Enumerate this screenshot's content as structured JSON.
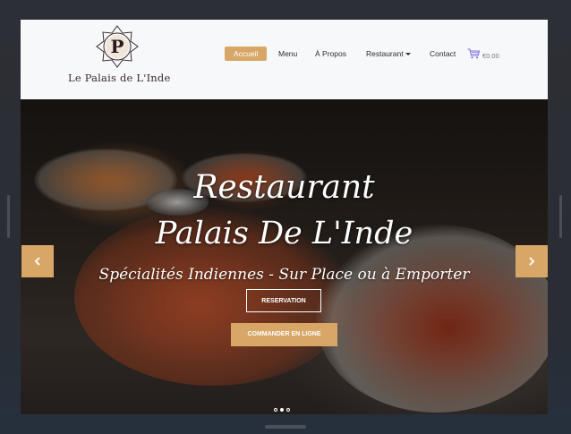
{
  "header": {
    "logo_text": "Le Palais de L'Inde",
    "logo_letter": "P",
    "nav": [
      "Accueil",
      "Menu",
      "À Propos",
      "Restaurant",
      "Contact"
    ],
    "active_nav": "Accueil",
    "cart_amount": "€0.00"
  },
  "hero": {
    "title_line1": "Restaurant",
    "title_line2": "Palais De L'Inde",
    "subtitle": "Spécialités Indiennes - Sur Place ou à Emporter",
    "reservation_label": "RESERVATION",
    "order_label": "COMMANDER EN LIGNE",
    "slide_count": 3,
    "active_slide": 1
  },
  "colors": {
    "accent": "#d8a767",
    "header_bg": "#f7f8fa",
    "page_bg": "#2c2f35"
  },
  "icons": [
    "cart-icon",
    "chevron-left-icon",
    "chevron-right-icon",
    "caret-down-icon"
  ]
}
